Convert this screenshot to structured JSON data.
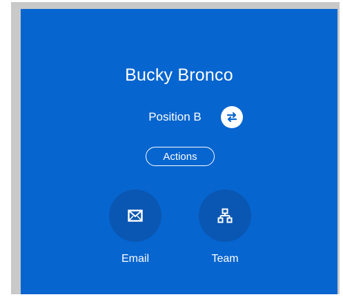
{
  "profile": {
    "name": "Bucky Bronco",
    "position": "Position B"
  },
  "actions_label": "Actions",
  "quick_actions": [
    {
      "label": "Email",
      "icon": "envelope-icon"
    },
    {
      "label": "Team",
      "icon": "org-chart-icon"
    }
  ],
  "colors": {
    "card_background": "#0765cf",
    "circle_background": "#0a57b3",
    "frame_border": "#c9c9c9"
  }
}
